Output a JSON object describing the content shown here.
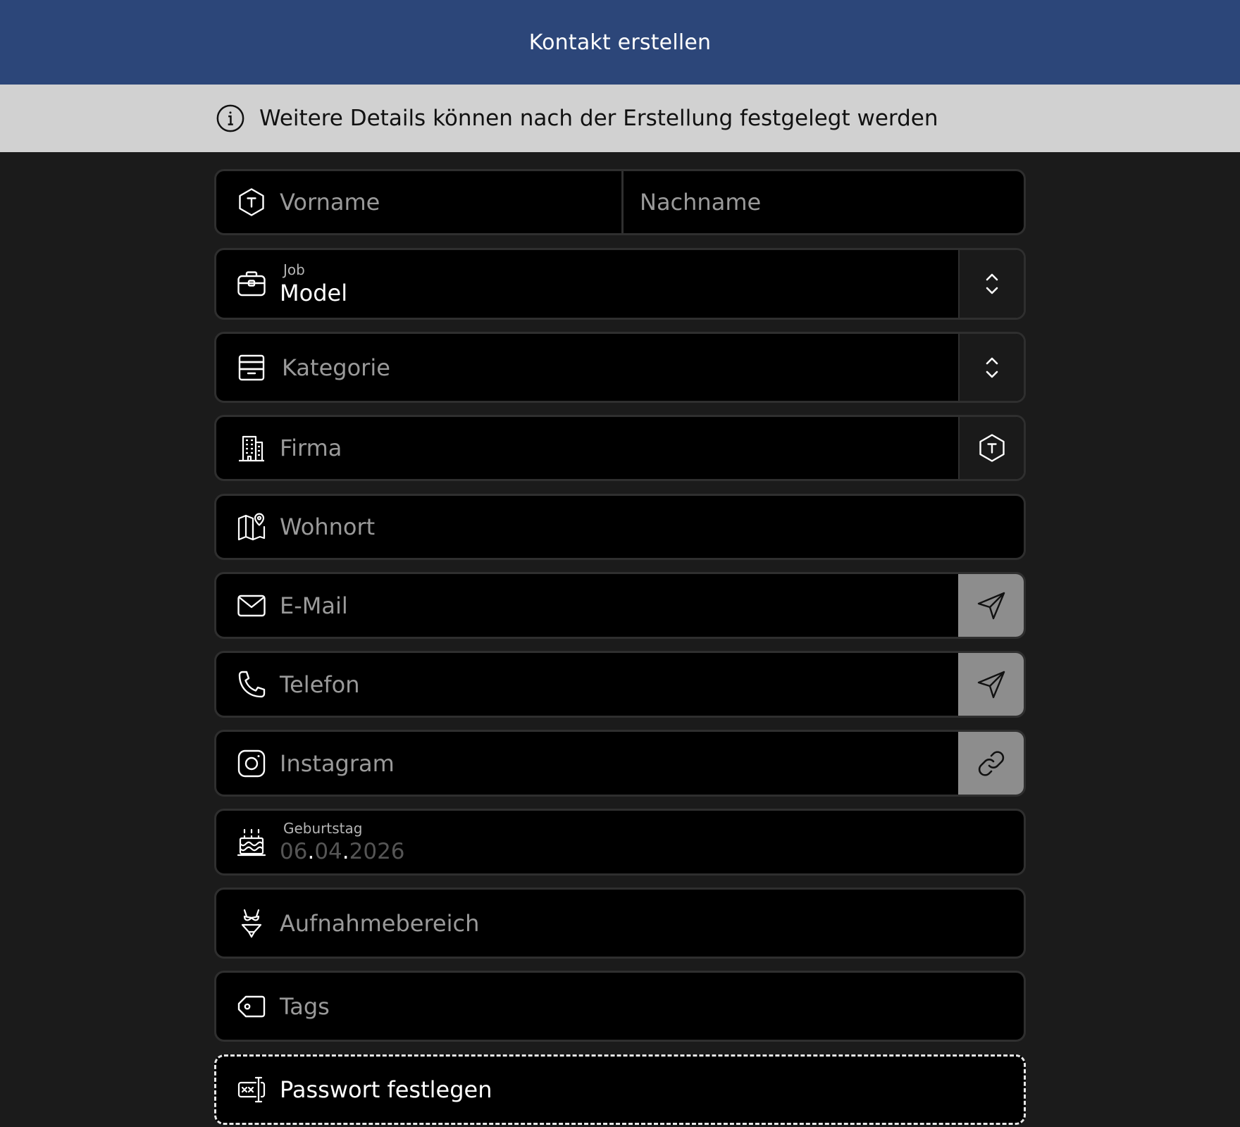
{
  "header": {
    "title": "Kontakt erstellen"
  },
  "info": {
    "text": "Weitere Details können nach der Erstellung festgelegt werden"
  },
  "form": {
    "firstname_placeholder": "Vorname",
    "lastname_placeholder": "Nachname",
    "job": {
      "label": "Job",
      "value": "Model"
    },
    "category_placeholder": "Kategorie",
    "company_placeholder": "Firma",
    "residence_placeholder": "Wohnort",
    "email_placeholder": "E-Mail",
    "phone_placeholder": "Telefon",
    "instagram_placeholder": "Instagram",
    "birthday": {
      "label": "Geburtstag",
      "day": "06",
      "month": "04",
      "year": "2026",
      "separator": "."
    },
    "shooting_area_placeholder": "Aufnahmebereich",
    "tags_placeholder": "Tags",
    "password_button": "Passwort festlegen"
  },
  "colors": {
    "header": "#2c4679",
    "info_bar": "#d1d1d1",
    "background": "#1b1b1b",
    "field": "#000000",
    "action_button": "#8d8d8d"
  }
}
